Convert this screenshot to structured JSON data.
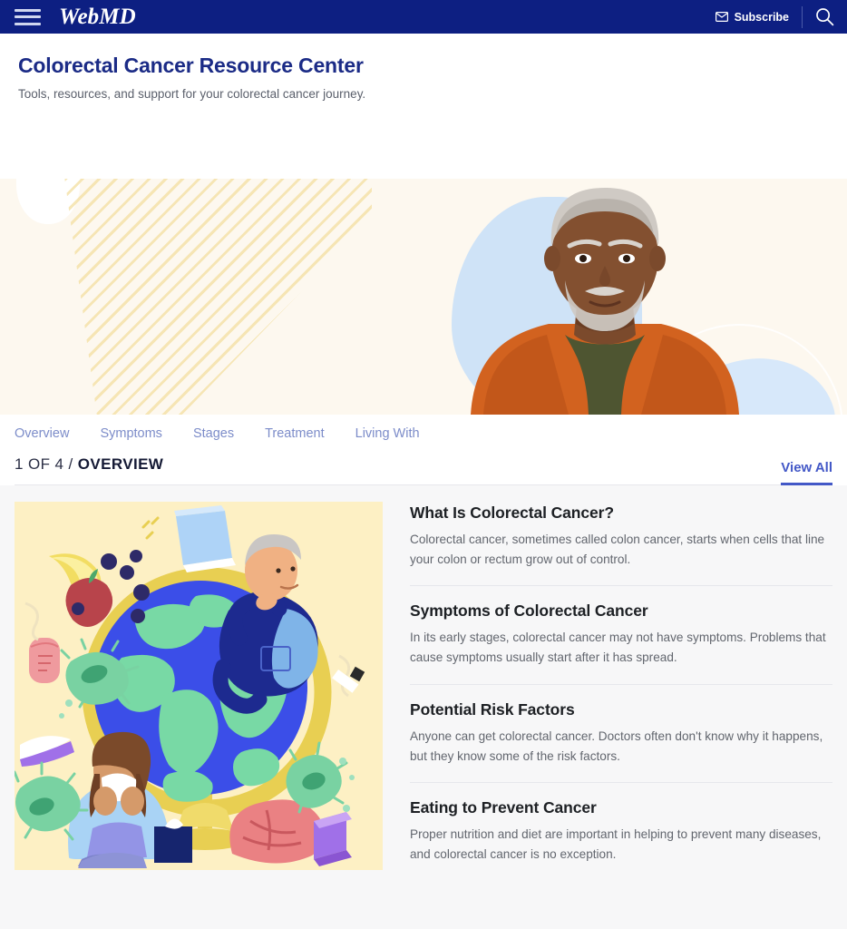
{
  "topbar": {
    "menu_icon": "hamburger-menu-icon",
    "brand": "WebMD",
    "subscribe_label": "Subscribe",
    "subscribe_icon": "envelope-icon",
    "search_icon": "search-icon"
  },
  "header": {
    "title": "Colorectal Cancer Resource Center",
    "subtitle": "Tools, resources, and support for your colorectal cancer journey."
  },
  "hero": {
    "alt": "Older man in an orange shirt over an olive t-shirt"
  },
  "tabs": [
    {
      "label": "Overview"
    },
    {
      "label": "Symptoms"
    },
    {
      "label": "Stages"
    },
    {
      "label": "Treatment"
    },
    {
      "label": "Living With"
    }
  ],
  "subhead": {
    "counter": "1 OF 4 / ",
    "section": "OVERVIEW",
    "view_all": "View All"
  },
  "illustration": {
    "alt": "Illustration of a globe surrounded by a man, a sick woman with tissues, germs, fruit, books and a brain"
  },
  "articles": [
    {
      "title": "What Is Colorectal Cancer?",
      "summary": "Colorectal cancer, sometimes called colon cancer, starts when cells that line your colon or rectum grow out of control."
    },
    {
      "title": "Symptoms of Colorectal Cancer",
      "summary": "In its early stages, colorectal cancer may not have symptoms. Problems that cause symptoms usually start after it has spread."
    },
    {
      "title": "Potential Risk Factors",
      "summary": "Anyone can get colorectal cancer. Doctors often don't know why it happens, but they know some of the risk factors."
    },
    {
      "title": "Eating to Prevent Cancer",
      "summary": "Proper nutrition and diet are important in helping to prevent many diseases, and colorectal cancer is no exception."
    }
  ],
  "colors": {
    "navy": "#0d1f82",
    "title_blue": "#1b2b86",
    "link_blue": "#4358c7",
    "tab_blue": "#7c8cc9",
    "hero_cream": "#fdf8ef",
    "illus_cream": "#fdf0c4",
    "page_bg": "#f7f7f8"
  }
}
